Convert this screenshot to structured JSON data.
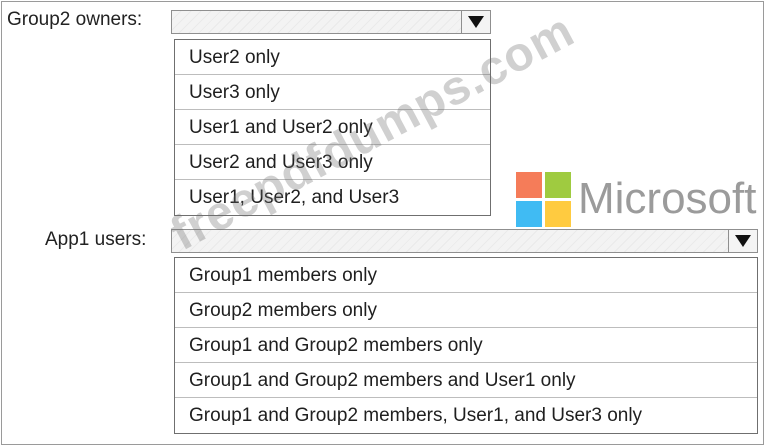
{
  "group2_owners": {
    "label": "Group2 owners:",
    "options": [
      "User2 only",
      "User3 only",
      "User1 and User2 only",
      "User2 and User3 only",
      "User1, User2, and User3"
    ]
  },
  "app1_users": {
    "label": "App1 users:",
    "options": [
      "Group1 members only",
      "Group2 members only",
      "Group1 and Group2 members only",
      "Group1 and Group2 members and User1 only",
      "Group1 and Group2 members, User1, and User3 only"
    ]
  },
  "logo": {
    "brand_name": "Microsoft",
    "colors": [
      "#f25022",
      "#7fba00",
      "#00a4ef",
      "#ffb900"
    ]
  },
  "watermark": {
    "text": "freepdfdumps.com"
  },
  "icons": {
    "dropdown_arrow": "caret-down-icon"
  }
}
